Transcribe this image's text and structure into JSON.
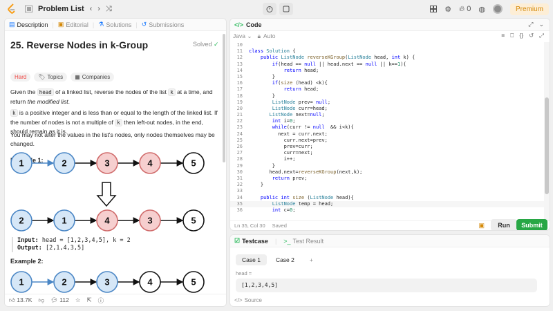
{
  "topbar": {
    "problem_list_label": "Problem List",
    "premium_label": "Premium",
    "streak_count": "0"
  },
  "left_tabs": [
    {
      "label": "Description",
      "active": true
    },
    {
      "label": "Editorial",
      "active": false
    },
    {
      "label": "Solutions",
      "active": false
    },
    {
      "label": "Submissions",
      "active": false
    }
  ],
  "problem": {
    "title": "25. Reverse Nodes in k-Group",
    "status": "Solved",
    "difficulty": "Hard",
    "topics_label": "Topics",
    "companies_label": "Companies",
    "para1_a": "Given the ",
    "para1_code1": "head",
    "para1_b": " of a linked list, reverse the nodes of the list ",
    "para1_code2": "k",
    "para1_c": " at a time, and return ",
    "para1_d": "the modified list",
    "para1_e": ".",
    "para2_code1": "k",
    "para2_a": " is a positive integer and is less than or equal to the length of the linked list. If the number of nodes is not a multiple of ",
    "para2_code2": "k",
    "para2_b": " then left-out nodes, in the end, should remain as it is.",
    "para3": "You may not alter the values in the list's nodes, only nodes themselves may be changed.",
    "example1_title": "Example 1:",
    "example1_input_label": "Input:",
    "example1_input": "head = [1,2,3,4,5], k = 2",
    "example1_output_label": "Output:",
    "example1_output": "[2,1,4,3,5]",
    "example2_title": "Example 2:"
  },
  "diagram": {
    "row1": [
      "1",
      "2",
      "3",
      "4",
      "5"
    ],
    "row2": [
      "2",
      "1",
      "4",
      "3",
      "5"
    ],
    "row3": [
      "1",
      "2",
      "3",
      "4",
      "5"
    ]
  },
  "footer": {
    "likes": "13.7K",
    "comments": "112"
  },
  "code_panel": {
    "title": "Code",
    "language": "Java",
    "save_mode": "Auto",
    "cursor_status": "Ln 35, Col 30",
    "saved_status": "Saved",
    "run_label": "Run",
    "submit_label": "Submit"
  },
  "code_lines": [
    {
      "n": "10",
      "t": ""
    },
    {
      "n": "11",
      "t": "class Solution {"
    },
    {
      "n": "12",
      "t": "    public ListNode reverseKGroup(ListNode head, int k) {"
    },
    {
      "n": "13",
      "t": "        if(head == null || head.next == null || k==1){"
    },
    {
      "n": "14",
      "t": "            return head;"
    },
    {
      "n": "15",
      "t": "        }"
    },
    {
      "n": "16",
      "t": "        if(size (head) <k){"
    },
    {
      "n": "17",
      "t": "            return head;"
    },
    {
      "n": "18",
      "t": "        }"
    },
    {
      "n": "19",
      "t": "        ListNode prev= null;"
    },
    {
      "n": "20",
      "t": "        ListNode curr=head;"
    },
    {
      "n": "21",
      "t": "       ListNode next=null;"
    },
    {
      "n": "22",
      "t": "        int i=0;"
    },
    {
      "n": "23",
      "t": "        while(curr != null  && i<k){"
    },
    {
      "n": "24",
      "t": "          next = curr.next;"
    },
    {
      "n": "25",
      "t": "            curr.next=prev;"
    },
    {
      "n": "26",
      "t": "            prev=curr;"
    },
    {
      "n": "27",
      "t": "            curr=next;"
    },
    {
      "n": "28",
      "t": "            i++;"
    },
    {
      "n": "29",
      "t": "        }"
    },
    {
      "n": "30",
      "t": "       head.next=reverseKGroup(next,k);"
    },
    {
      "n": "31",
      "t": "        return prev;"
    },
    {
      "n": "32",
      "t": "    }"
    },
    {
      "n": "33",
      "t": ""
    },
    {
      "n": "34",
      "t": "    public int size (ListNode head){"
    },
    {
      "n": "35",
      "t": "        ListNode temp = head;"
    },
    {
      "n": "36",
      "t": "        int c=0;"
    }
  ],
  "test_panel": {
    "testcase_label": "Testcase",
    "result_label": "Test Result",
    "cases": [
      "Case 1",
      "Case 2"
    ],
    "var_name": "head =",
    "var_value": "[1,2,3,4,5]",
    "source_label": "Source"
  },
  "colors": {
    "node_blue_fill": "#d6e7f7",
    "node_blue_stroke": "#4a86c5",
    "node_red_fill": "#f6cfcf",
    "node_red_stroke": "#d06b6b",
    "submit_green": "#28a745",
    "hard_red": "#ef4743"
  }
}
